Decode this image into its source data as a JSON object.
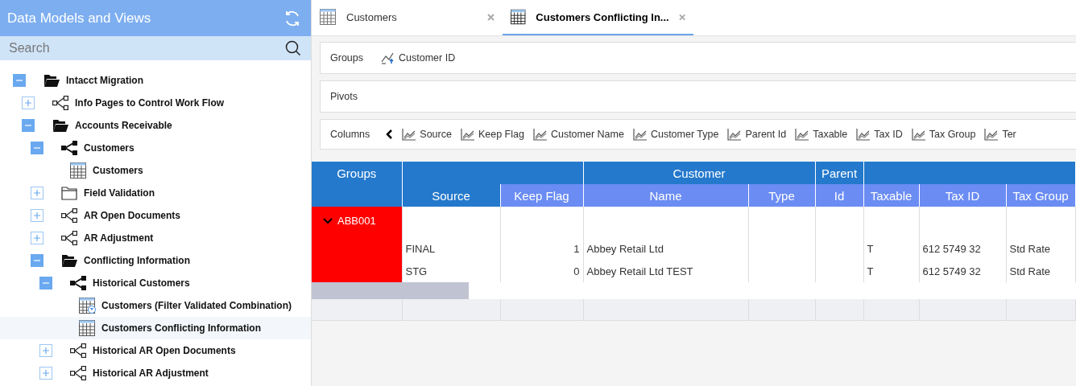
{
  "sidebar": {
    "title": "Data Models and Views",
    "search": {
      "placeholder": "Search"
    },
    "tree": [
      {
        "label": "Intacct Migration",
        "kind": "folder-open",
        "expanded": true,
        "selected": false,
        "children": [
          {
            "label": "Info Pages to Control Work Flow",
            "kind": "model-outline",
            "expanded": false,
            "selected": false
          },
          {
            "label": "Accounts Receivable",
            "kind": "folder-open",
            "expanded": true,
            "selected": false,
            "children": [
              {
                "label": "Customers",
                "kind": "model",
                "expanded": true,
                "selected": false,
                "children": [
                  {
                    "label": "Customers",
                    "kind": "grid",
                    "selected": false
                  }
                ]
              },
              {
                "label": "Field Validation",
                "kind": "folder",
                "expanded": false,
                "selected": false
              },
              {
                "label": "AR Open Documents",
                "kind": "model-outline",
                "expanded": false,
                "selected": false
              },
              {
                "label": "AR Adjustment",
                "kind": "model-outline",
                "expanded": false,
                "selected": false
              },
              {
                "label": "Conflicting Information",
                "kind": "folder-open",
                "expanded": true,
                "selected": false,
                "children": [
                  {
                    "label": "Historical Customers",
                    "kind": "model",
                    "expanded": true,
                    "selected": false,
                    "children": [
                      {
                        "label": "Customers (Filter Validated Combination)",
                        "kind": "grid-filter",
                        "selected": false
                      },
                      {
                        "label": "Customers Conflicting Information",
                        "kind": "grid",
                        "selected": true
                      }
                    ]
                  },
                  {
                    "label": "Historical AR Open Documents",
                    "kind": "model-outline",
                    "expanded": false,
                    "selected": false
                  },
                  {
                    "label": "Historical AR Adjustment",
                    "kind": "model-outline",
                    "expanded": false,
                    "selected": false
                  }
                ]
              }
            ]
          }
        ]
      }
    ]
  },
  "tabs": [
    {
      "label": "Customers",
      "selected": false
    },
    {
      "label": "Customers Conflicting In...",
      "selected": true
    }
  ],
  "groups_bar": {
    "label": "Groups",
    "items": [
      "Customer ID"
    ]
  },
  "pivots_bar": {
    "label": "Pivots"
  },
  "columns_bar": {
    "label": "Columns",
    "items": [
      "Source",
      "Keep Flag",
      "Customer Name",
      "Customer Type",
      "Parent Id",
      "Taxable",
      "Tax ID",
      "Tax Group",
      "Ter"
    ]
  },
  "table": {
    "groups_header": "Groups",
    "column_groups": [
      {
        "columns": [
          {
            "label": "Source",
            "kind": "primary"
          },
          {
            "label": "Keep Flag",
            "kind": "number"
          }
        ]
      },
      {
        "title": "Customer",
        "columns": [
          {
            "label": "Name",
            "kind": "text"
          },
          {
            "label": "Type",
            "kind": "text"
          }
        ]
      },
      {
        "title": "Parent",
        "columns": [
          {
            "label": "Id",
            "kind": "text"
          }
        ]
      },
      {
        "columns": [
          {
            "label": "Taxable",
            "kind": "text"
          },
          {
            "label": "Tax ID",
            "kind": "text"
          },
          {
            "label": "Tax Group",
            "kind": "text"
          }
        ]
      }
    ],
    "groups": [
      {
        "label": "ABB001",
        "expanded": true,
        "rows": [
          [
            "FINAL",
            "1",
            "Abbey Retail Ltd",
            null,
            null,
            "T",
            "612 5749 32",
            "Std Rate"
          ],
          [
            "STG",
            "0",
            "Abbey Retail Ltd TEST",
            null,
            null,
            "T",
            "612 5749 32",
            "Std Rate"
          ]
        ]
      }
    ]
  }
}
